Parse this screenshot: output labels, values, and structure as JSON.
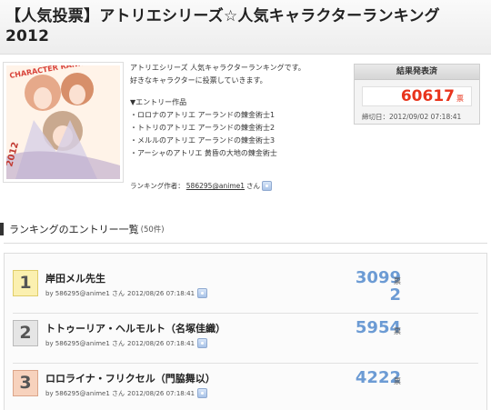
{
  "page": {
    "title": "【人気投票】アトリエシリーズ☆人気キャラクターランキング 2012"
  },
  "description": {
    "line1": "アトリエシリーズ 人気キャラクターランキングです。",
    "line2": "好きなキャラクターに投票していきます。",
    "entries_heading": "▼エントリー作品",
    "entries": [
      "・ロロナのアトリエ アーランドの錬金術士1",
      "・トトリのアトリエ アーランドの錬金術士2",
      "・メルルのアトリエ アーランドの錬金術士3",
      "・アーシャのアトリエ 黄昏の大地の錬金術士"
    ],
    "author_label": "ランキング作者：",
    "author_name": "586295@anime1",
    "author_suffix": "さん"
  },
  "result": {
    "heading": "結果発表済",
    "total_votes": "60617",
    "unit": "票",
    "deadline": "締切日：2012/09/02 07:18:41"
  },
  "section": {
    "title": "ランキングのエントリー一覧",
    "count": "(50件)"
  },
  "entries": [
    {
      "rank": "1",
      "name": "岸田メル先生",
      "user": "by 586295@anime1 さん",
      "date": "2012/08/26 07:18:41",
      "votes_line1": "3099",
      "votes_line2": "2",
      "unit": "票"
    },
    {
      "rank": "2",
      "name": "トトゥーリア・ヘルモルト（名塚佳織）",
      "user": "by 586295@anime1 さん",
      "date": "2012/08/26 07:18:41",
      "votes_line1": "5954",
      "votes_line2": "",
      "unit": "票"
    },
    {
      "rank": "3",
      "name": "ロロライナ・フリクセル（門脇舞以）",
      "user": "by 586295@anime1 さん",
      "date": "2012/08/26 07:18:41",
      "votes_line1": "4222",
      "votes_line2": "",
      "unit": "票"
    }
  ],
  "colors": {
    "total_votes": "#e8341c",
    "entry_votes": "#6c9bd4"
  },
  "cover": {
    "text_top": "CHARACTER RANKING",
    "text_bottom": "2012"
  }
}
